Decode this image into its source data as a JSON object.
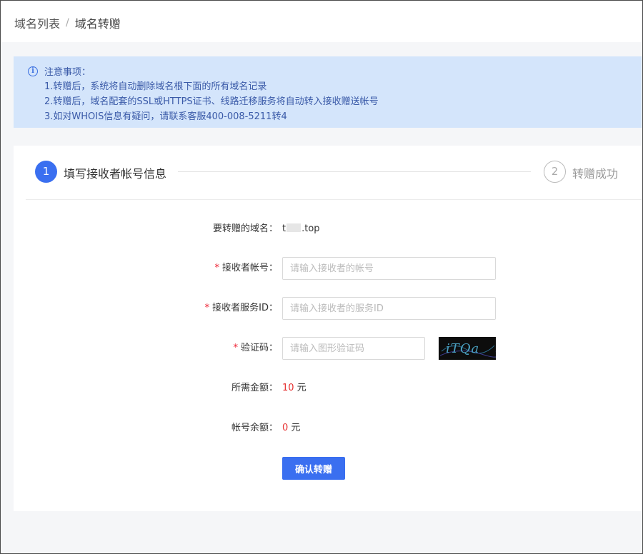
{
  "breadcrumb": {
    "items": [
      "域名列表",
      "域名转赠"
    ],
    "separator": "/"
  },
  "notice": {
    "icon": "info-icon",
    "title": "注意事项：",
    "lines": [
      "1.转赠后，系统将自动删除域名根下面的所有域名记录",
      "2.转赠后，域名配套的SSL或HTTPS证书、线路迁移服务将自动转入接收赠送帐号",
      "3.如对WHOIS信息有疑问，请联系客服400-008-5211转4"
    ]
  },
  "steps": [
    {
      "number": "1",
      "label": "填写接收者帐号信息",
      "active": true
    },
    {
      "number": "2",
      "label": "转赠成功",
      "active": false
    }
  ],
  "form": {
    "domain": {
      "label": "要转赠的域名：",
      "value_prefix": "t",
      "value_suffix": ".top"
    },
    "account": {
      "required": "*",
      "label": "接收者帐号：",
      "placeholder": "请输入接收者的帐号",
      "value": ""
    },
    "service_id": {
      "required": "*",
      "label": "接收者服务ID：",
      "placeholder": "请输入接收者的服务ID",
      "value": ""
    },
    "captcha": {
      "required": "*",
      "label": "验证码：",
      "placeholder": "请输入图形验证码",
      "value": "",
      "image_text": "iTQa"
    },
    "amount": {
      "label": "所需金额：",
      "value": "10",
      "unit": " 元"
    },
    "balance": {
      "label": "帐号余额：",
      "value": "0",
      "unit": " 元"
    },
    "submit_label": "确认转赠"
  },
  "colors": {
    "primary": "#3a6ff0",
    "notice_bg": "#d4e5fb",
    "notice_text": "#3a5aa8",
    "required": "#e23333",
    "price": "#e63030"
  }
}
